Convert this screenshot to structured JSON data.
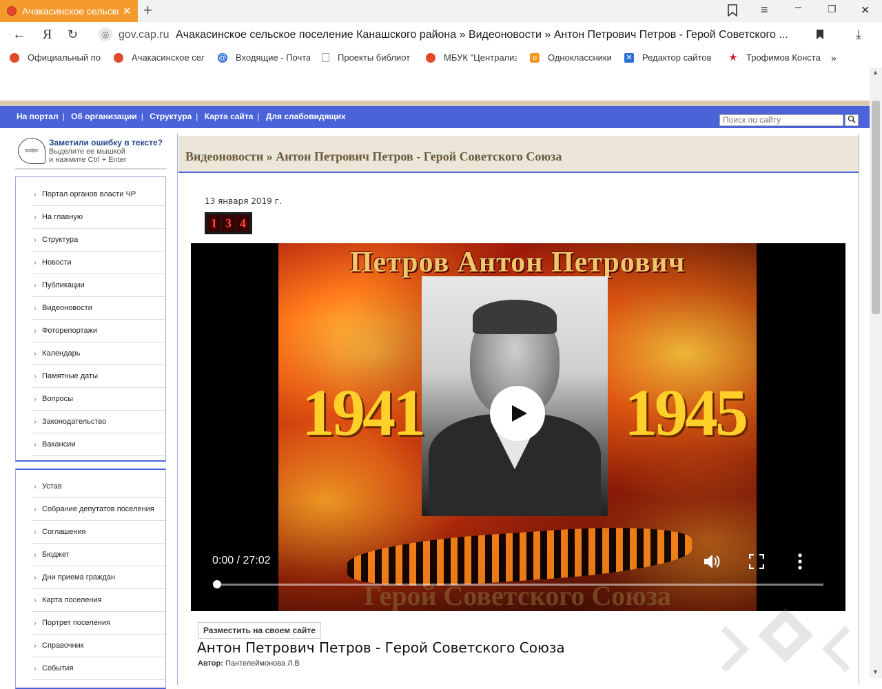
{
  "browser": {
    "tab_title": "Ачакасинское сельское п",
    "domain": "gov.cap.ru",
    "page_title": "Ачакасинское сельское поселение Канашского района » Видеоновости » Антон Петрович Петров - Герой Советского ...",
    "bookmarks": [
      {
        "label": "Официальный по",
        "icon": "emblem-icon",
        "color": "#e0492a"
      },
      {
        "label": "Ачакасинское сел",
        "icon": "emblem-icon",
        "color": "#e0492a"
      },
      {
        "label": "Входящие - Почта",
        "icon": "mail-at-icon",
        "color": "#2f6fd8"
      },
      {
        "label": "Проекты библиот",
        "icon": "doc-icon",
        "color": "#999999"
      },
      {
        "label": "МБУК \"Централиз",
        "icon": "emblem-icon",
        "color": "#e0492a"
      },
      {
        "label": "Одноклассники",
        "icon": "ok-icon",
        "color": "#f7931e"
      },
      {
        "label": "Редактор сайтов",
        "icon": "editor-icon",
        "color": "#2f6fd8"
      },
      {
        "label": "Трофимов Конста",
        "icon": "star-icon",
        "color": "#d8202a"
      }
    ]
  },
  "navbar": {
    "links": [
      "На портал",
      "Об организации",
      "Структура",
      "Карта сайта",
      "Для слабовидящих"
    ],
    "search_placeholder": "Поиск по сайту"
  },
  "orphus": {
    "logo_text": "орфус",
    "heading": "Заметили ошибку в тексте?",
    "line1": "Выделите ее мышкой",
    "line2": "и нажмите Ctrl + Enter"
  },
  "menu1": [
    "Портал органов власти ЧР",
    "На главную",
    "Структура",
    "Новости",
    "Публикации",
    "Видеоновости",
    "Фоторепортажи",
    "Календарь",
    "Памятные даты",
    "Вопросы",
    "Законодательство",
    "Вакансии"
  ],
  "menu2": [
    "Устав",
    "Собрание депутатов поселения",
    "Соглашения",
    "Бюджет",
    "Дни приема граждан",
    "Карта поселения",
    "Портрет поселения",
    "Справочник",
    "События"
  ],
  "breadcrumb": "Видеоновости » Антон Петрович Петров - Герой Советского Союза",
  "article": {
    "date": "13 января 2019 г.",
    "views_digits": [
      "1",
      "3",
      "4"
    ],
    "embed_label": "Разместить на своем сайте",
    "title": "Антон Петрович Петров - Герой Советского Союза",
    "author_label": "Автор:",
    "author": "Пантелеймонова Л.В"
  },
  "video": {
    "poster_title": "Петров Антон Петрович",
    "year_left": "1941",
    "year_right": "1945",
    "poster_subtitle": "Герой Советского Союза",
    "time": "0:00 / 27:02",
    "progress": 0
  }
}
